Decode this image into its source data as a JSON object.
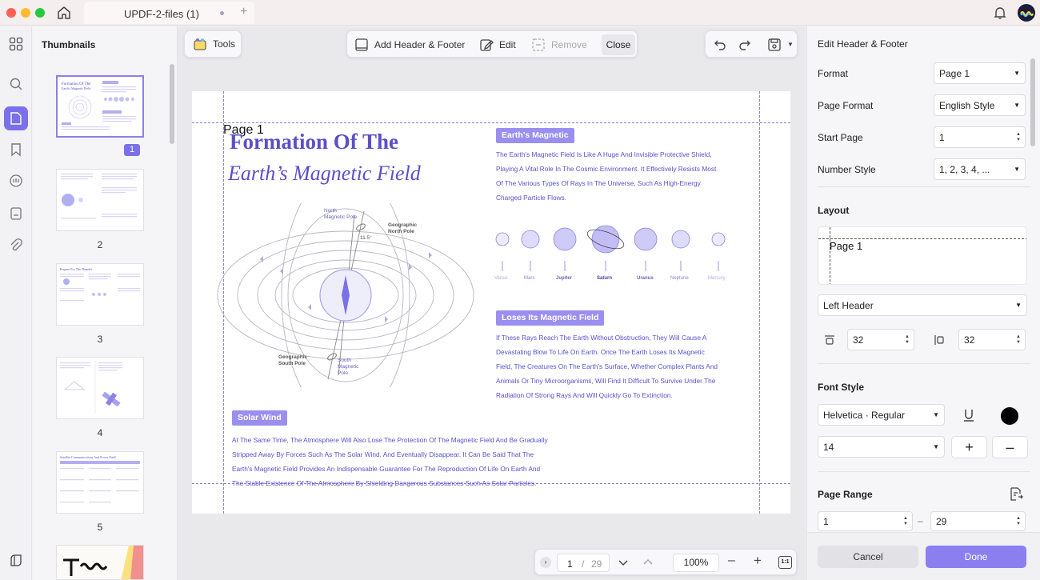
{
  "window": {
    "tab_title": "UPDF-2-files (1)",
    "add_tab": "+"
  },
  "sidebar": {
    "title": "Thumbnails",
    "pages": [
      "1",
      "2",
      "3",
      "4",
      "5"
    ]
  },
  "toolbar": {
    "tools": "Tools",
    "add_header_footer": "Add Header & Footer",
    "edit": "Edit",
    "remove": "Remove",
    "close": "Close"
  },
  "document": {
    "header_text": "Page 1",
    "title_line1": "Formation Of The",
    "title_line2": "Earth’s Magnetic Field",
    "diagram_labels": {
      "north_magnetic": "North\nMagnetic Pole",
      "geo_north": "Geographic\nNorth Pole",
      "geo_south": "Geographic\nSouth Pole",
      "south_magnetic": "South\nMagnetic\nPole",
      "angle": "11.5°"
    },
    "sec1_title": "Earth's Magnetic",
    "sec1_lines": [
      "The Earth's Magnetic Field Is Like A Huge And Invisible Protective Shield,",
      "Playing A Vital Role In The Cosmic Environment. It Effectively Resists Most",
      "Of The Various Types Of Rays In The Universe, Such As High-Energy",
      "Charged Particle Flows."
    ],
    "planets": [
      "Venus",
      "Mars",
      "Jupiter",
      "Saturn",
      "Uranus",
      "Neptune",
      "Mercury"
    ],
    "sec2_title": "Loses Its Magnetic Field",
    "sec2_lines": [
      "If These Rays Reach The Earth Without Obstruction, They Will Cause A",
      "Devastating Blow To Life On Earth. Once The Earth Loses Its Magnetic",
      "Field, The Creatures On The Earth's Surface, Whether Complex Plants And",
      "Animals Or Tiny Microorganisms, Will Find It Difficult To Survive Under The",
      "Radiation Of Strong Rays And Will Quickly Go To Extinction."
    ],
    "sec3_title": "Solar Wind",
    "sec3_lines": [
      "At The Same Time, The Atmosphere Will Also Lose The Protection Of The Magnetic Field And Be Gradually",
      "Stripped Away By Forces Such As The Solar Wind, And Eventually Disappear. It Can Be Said That The",
      "Earth's Magnetic Field Provides An Indispensable Guarantee For The Reproduction Of Life On Earth And",
      "The Stable Existence Of The Atmosphere By Shielding Dangerous Substances Such As Solar Particles."
    ]
  },
  "pager": {
    "current": "1",
    "separator": "/",
    "total": "29",
    "zoom": "100%"
  },
  "panel": {
    "title": "Edit Header & Footer",
    "format_label": "Format",
    "format_value": "Page 1",
    "page_format_label": "Page Format",
    "page_format_value": "English Style",
    "start_page_label": "Start Page",
    "start_page_value": "1",
    "number_style_label": "Number Style",
    "number_style_value": "1, 2, 3, 4, ...",
    "layout_title": "Layout",
    "layout_preview": "Page 1",
    "position_value": "Left Header",
    "margin_top": "32",
    "margin_side": "32",
    "font_title": "Font Style",
    "font_value": "Helvetica · Regular",
    "font_size": "14",
    "font_color": "#000000",
    "range_title": "Page Range",
    "range_from": "1",
    "range_dash": "–",
    "range_to": "29",
    "cancel": "Cancel",
    "done": "Done"
  },
  "colors": {
    "accent": "#7a70e8",
    "doc_text": "#5a50c8",
    "done_button": "#8b7ff0"
  }
}
